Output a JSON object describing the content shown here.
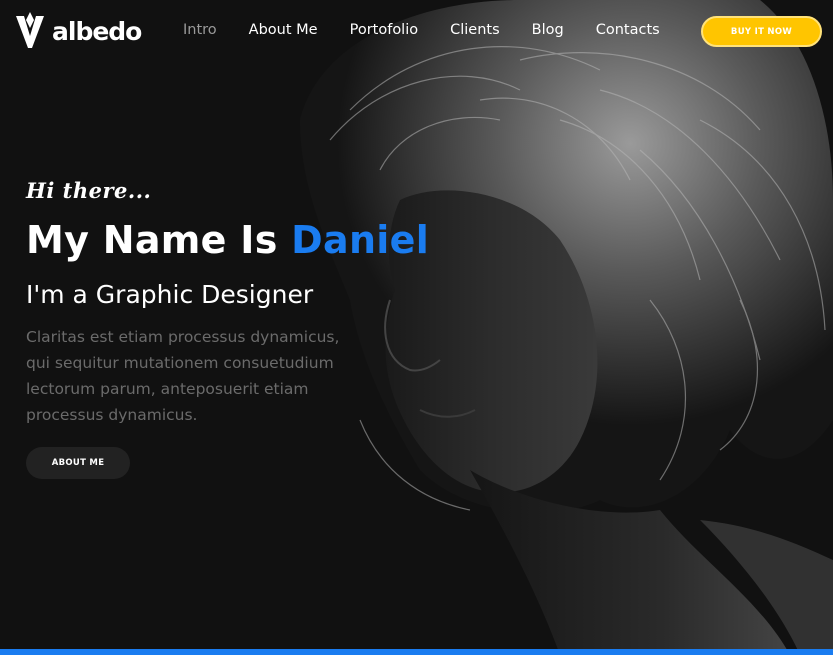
{
  "brand": {
    "name": "albedo",
    "icon": "albedo-logo-icon"
  },
  "nav": {
    "items": [
      {
        "label": "Intro",
        "active": true
      },
      {
        "label": "About Me",
        "active": false
      },
      {
        "label": "Portofolio",
        "active": false
      },
      {
        "label": "Clients",
        "active": false
      },
      {
        "label": "Blog",
        "active": false
      },
      {
        "label": "Contacts",
        "active": false
      }
    ],
    "buy_label": "BUY IT NOW"
  },
  "hero": {
    "greeting": "Hi there...",
    "headline_prefix": "My Name Is ",
    "headline_name": "Daniel",
    "subheadline": "I'm a Graphic Designer",
    "description": "Claritas est etiam processus dynamicus, qui sequitur mutationem consuetudium lectorum parum, anteposuerit etiam processus dynamicus.",
    "cta_label": "ABOUT ME"
  },
  "colors": {
    "background": "#111111",
    "accent_blue": "#1a7cf0",
    "accent_yellow": "#ffc500",
    "muted_text": "#6b6b6b"
  }
}
